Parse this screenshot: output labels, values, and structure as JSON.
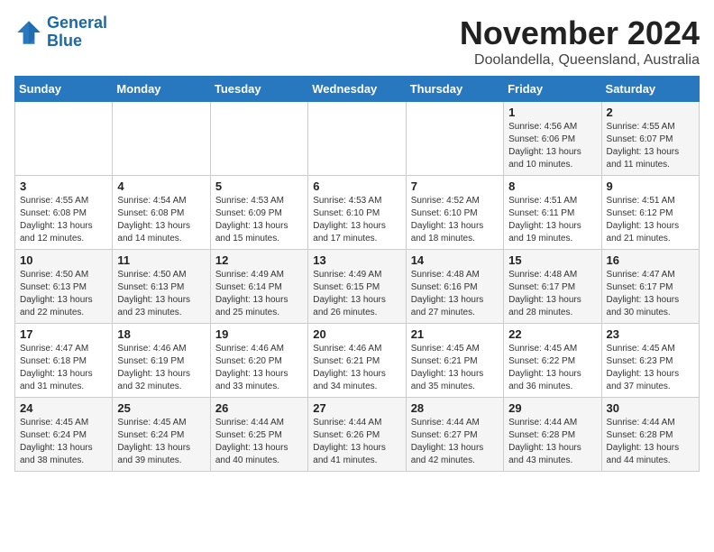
{
  "header": {
    "logo_line1": "General",
    "logo_line2": "Blue",
    "month": "November 2024",
    "location": "Doolandella, Queensland, Australia"
  },
  "weekdays": [
    "Sunday",
    "Monday",
    "Tuesday",
    "Wednesday",
    "Thursday",
    "Friday",
    "Saturday"
  ],
  "weeks": [
    [
      {
        "day": "",
        "info": ""
      },
      {
        "day": "",
        "info": ""
      },
      {
        "day": "",
        "info": ""
      },
      {
        "day": "",
        "info": ""
      },
      {
        "day": "",
        "info": ""
      },
      {
        "day": "1",
        "info": "Sunrise: 4:56 AM\nSunset: 6:06 PM\nDaylight: 13 hours\nand 10 minutes."
      },
      {
        "day": "2",
        "info": "Sunrise: 4:55 AM\nSunset: 6:07 PM\nDaylight: 13 hours\nand 11 minutes."
      }
    ],
    [
      {
        "day": "3",
        "info": "Sunrise: 4:55 AM\nSunset: 6:08 PM\nDaylight: 13 hours\nand 12 minutes."
      },
      {
        "day": "4",
        "info": "Sunrise: 4:54 AM\nSunset: 6:08 PM\nDaylight: 13 hours\nand 14 minutes."
      },
      {
        "day": "5",
        "info": "Sunrise: 4:53 AM\nSunset: 6:09 PM\nDaylight: 13 hours\nand 15 minutes."
      },
      {
        "day": "6",
        "info": "Sunrise: 4:53 AM\nSunset: 6:10 PM\nDaylight: 13 hours\nand 17 minutes."
      },
      {
        "day": "7",
        "info": "Sunrise: 4:52 AM\nSunset: 6:10 PM\nDaylight: 13 hours\nand 18 minutes."
      },
      {
        "day": "8",
        "info": "Sunrise: 4:51 AM\nSunset: 6:11 PM\nDaylight: 13 hours\nand 19 minutes."
      },
      {
        "day": "9",
        "info": "Sunrise: 4:51 AM\nSunset: 6:12 PM\nDaylight: 13 hours\nand 21 minutes."
      }
    ],
    [
      {
        "day": "10",
        "info": "Sunrise: 4:50 AM\nSunset: 6:13 PM\nDaylight: 13 hours\nand 22 minutes."
      },
      {
        "day": "11",
        "info": "Sunrise: 4:50 AM\nSunset: 6:13 PM\nDaylight: 13 hours\nand 23 minutes."
      },
      {
        "day": "12",
        "info": "Sunrise: 4:49 AM\nSunset: 6:14 PM\nDaylight: 13 hours\nand 25 minutes."
      },
      {
        "day": "13",
        "info": "Sunrise: 4:49 AM\nSunset: 6:15 PM\nDaylight: 13 hours\nand 26 minutes."
      },
      {
        "day": "14",
        "info": "Sunrise: 4:48 AM\nSunset: 6:16 PM\nDaylight: 13 hours\nand 27 minutes."
      },
      {
        "day": "15",
        "info": "Sunrise: 4:48 AM\nSunset: 6:17 PM\nDaylight: 13 hours\nand 28 minutes."
      },
      {
        "day": "16",
        "info": "Sunrise: 4:47 AM\nSunset: 6:17 PM\nDaylight: 13 hours\nand 30 minutes."
      }
    ],
    [
      {
        "day": "17",
        "info": "Sunrise: 4:47 AM\nSunset: 6:18 PM\nDaylight: 13 hours\nand 31 minutes."
      },
      {
        "day": "18",
        "info": "Sunrise: 4:46 AM\nSunset: 6:19 PM\nDaylight: 13 hours\nand 32 minutes."
      },
      {
        "day": "19",
        "info": "Sunrise: 4:46 AM\nSunset: 6:20 PM\nDaylight: 13 hours\nand 33 minutes."
      },
      {
        "day": "20",
        "info": "Sunrise: 4:46 AM\nSunset: 6:21 PM\nDaylight: 13 hours\nand 34 minutes."
      },
      {
        "day": "21",
        "info": "Sunrise: 4:45 AM\nSunset: 6:21 PM\nDaylight: 13 hours\nand 35 minutes."
      },
      {
        "day": "22",
        "info": "Sunrise: 4:45 AM\nSunset: 6:22 PM\nDaylight: 13 hours\nand 36 minutes."
      },
      {
        "day": "23",
        "info": "Sunrise: 4:45 AM\nSunset: 6:23 PM\nDaylight: 13 hours\nand 37 minutes."
      }
    ],
    [
      {
        "day": "24",
        "info": "Sunrise: 4:45 AM\nSunset: 6:24 PM\nDaylight: 13 hours\nand 38 minutes."
      },
      {
        "day": "25",
        "info": "Sunrise: 4:45 AM\nSunset: 6:24 PM\nDaylight: 13 hours\nand 39 minutes."
      },
      {
        "day": "26",
        "info": "Sunrise: 4:44 AM\nSunset: 6:25 PM\nDaylight: 13 hours\nand 40 minutes."
      },
      {
        "day": "27",
        "info": "Sunrise: 4:44 AM\nSunset: 6:26 PM\nDaylight: 13 hours\nand 41 minutes."
      },
      {
        "day": "28",
        "info": "Sunrise: 4:44 AM\nSunset: 6:27 PM\nDaylight: 13 hours\nand 42 minutes."
      },
      {
        "day": "29",
        "info": "Sunrise: 4:44 AM\nSunset: 6:28 PM\nDaylight: 13 hours\nand 43 minutes."
      },
      {
        "day": "30",
        "info": "Sunrise: 4:44 AM\nSunset: 6:28 PM\nDaylight: 13 hours\nand 44 minutes."
      }
    ]
  ]
}
